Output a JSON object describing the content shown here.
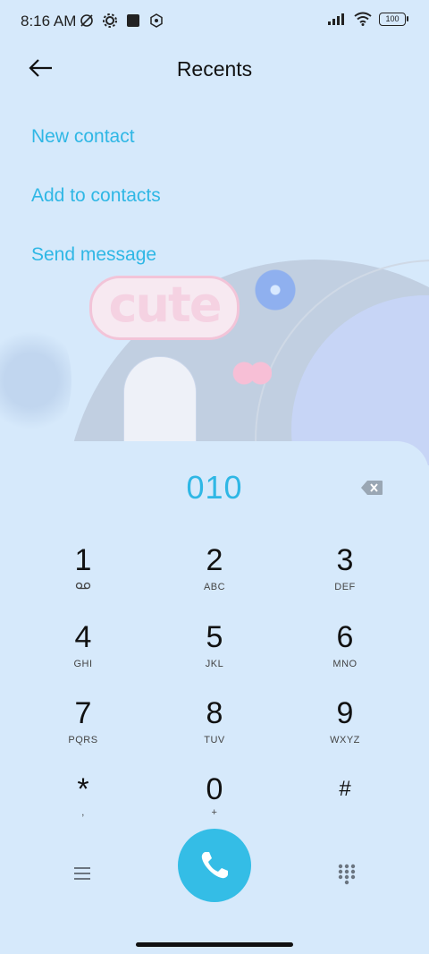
{
  "status_bar": {
    "time": "8:16 AM",
    "battery": "100"
  },
  "header": {
    "title": "Recents"
  },
  "actions": [
    {
      "label": "New contact"
    },
    {
      "label": "Add to contacts"
    },
    {
      "label": "Send message"
    }
  ],
  "wallpaper": {
    "text": "cute"
  },
  "dialer": {
    "number": "010",
    "keys": [
      {
        "digit": "1",
        "letters": ""
      },
      {
        "digit": "2",
        "letters": "ABC"
      },
      {
        "digit": "3",
        "letters": "DEF"
      },
      {
        "digit": "4",
        "letters": "GHI"
      },
      {
        "digit": "5",
        "letters": "JKL"
      },
      {
        "digit": "6",
        "letters": "MNO"
      },
      {
        "digit": "7",
        "letters": "PQRS"
      },
      {
        "digit": "8",
        "letters": "TUV"
      },
      {
        "digit": "9",
        "letters": "WXYZ"
      },
      {
        "digit": "*",
        "letters": ","
      },
      {
        "digit": "0",
        "letters": "+"
      },
      {
        "digit": "#",
        "letters": ""
      }
    ]
  },
  "colors": {
    "accent": "#2fb7e5",
    "call_button": "#34bde6",
    "background": "#d6e9fb"
  },
  "icons": {
    "back": "arrow-left-icon",
    "backspace": "backspace-icon",
    "menu": "menu-icon",
    "call": "phone-icon",
    "keypad": "dialpad-icon",
    "voicemail": "voicemail-icon"
  }
}
